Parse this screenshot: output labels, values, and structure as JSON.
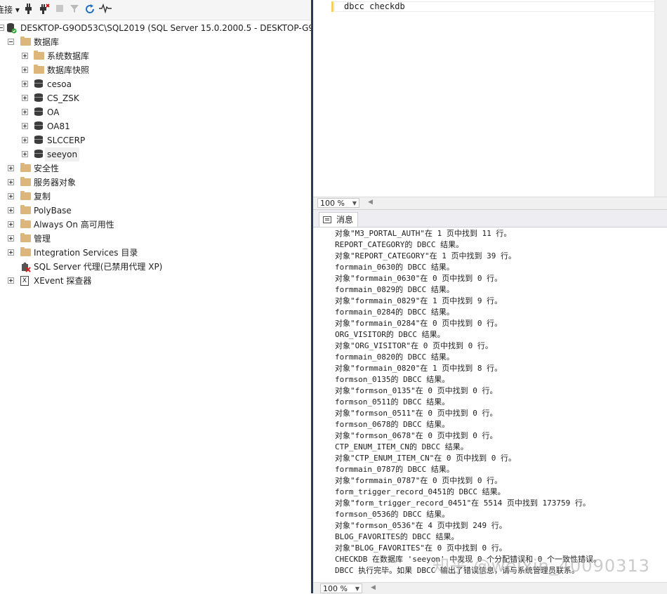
{
  "toolbar": {
    "connect_label": "连接",
    "icons": [
      "connect-plug-icon",
      "disconnect-plug-icon",
      "stop-icon",
      "filter-icon",
      "refresh-icon",
      "activity-monitor-icon"
    ]
  },
  "tree": {
    "server": "DESKTOP-G9OD53C\\SQL2019 (SQL Server 15.0.2000.5 - DESKTOP-G9O",
    "databases_folder": "数据库",
    "children": [
      {
        "label": "系统数据库",
        "type": "folder"
      },
      {
        "label": "数据库快照",
        "type": "folder"
      },
      {
        "label": "cesoa",
        "type": "db"
      },
      {
        "label": "CS_ZSK",
        "type": "db"
      },
      {
        "label": "OA",
        "type": "db"
      },
      {
        "label": "OA81",
        "type": "db"
      },
      {
        "label": "SLCCERP",
        "type": "db"
      },
      {
        "label": "seeyon",
        "type": "db"
      }
    ],
    "top_folders": [
      {
        "label": "安全性"
      },
      {
        "label": "服务器对象"
      },
      {
        "label": "复制"
      },
      {
        "label": "PolyBase"
      },
      {
        "label": "Always On 高可用性"
      },
      {
        "label": "管理"
      },
      {
        "label": "Integration Services 目录"
      }
    ],
    "agent": "SQL Server 代理(已禁用代理 XP)",
    "xevent": "XEvent 探查器"
  },
  "editor": {
    "code": "dbcc checkdb",
    "zoom": "100 %"
  },
  "results": {
    "tab_label": "消息",
    "zoom": "100 %",
    "messages": [
      "对象\"M3_PORTAL_AUTH\"在 1 页中找到 11 行。",
      "REPORT_CATEGORY的 DBCC 结果。",
      "对象\"REPORT_CATEGORY\"在 1 页中找到 39 行。",
      "formmain_0630的 DBCC 结果。",
      "对象\"formmain_0630\"在 0 页中找到 0 行。",
      "formmain_0829的 DBCC 结果。",
      "对象\"formmain_0829\"在 1 页中找到 9 行。",
      "formmain_0284的 DBCC 结果。",
      "对象\"formmain_0284\"在 0 页中找到 0 行。",
      "ORG_VISITOR的 DBCC 结果。",
      "对象\"ORG_VISITOR\"在 0 页中找到 0 行。",
      "formmain_0820的 DBCC 结果。",
      "对象\"formmain_0820\"在 1 页中找到 8 行。",
      "formson_0135的 DBCC 结果。",
      "对象\"formson_0135\"在 0 页中找到 0 行。",
      "formson_0511的 DBCC 结果。",
      "对象\"formson_0511\"在 0 页中找到 0 行。",
      "formson_0678的 DBCC 结果。",
      "对象\"formson_0678\"在 0 页中找到 0 行。",
      "CTP_ENUM_ITEM_CN的 DBCC 结果。",
      "对象\"CTP_ENUM_ITEM_CN\"在 0 页中找到 0 行。",
      "formmain_0787的 DBCC 结果。",
      "对象\"formmain_0787\"在 0 页中找到 0 行。",
      "form_trigger_record_0451的 DBCC 结果。",
      "对象\"form_trigger_record_0451\"在 5514 页中找到 173759 行。",
      "formson_0536的 DBCC 结果。",
      "对象\"formson_0536\"在 4 页中找到 249 行。",
      "BLOG_FAVORITES的 DBCC 结果。",
      "对象\"BLOG_FAVORITES\"在 0 页中找到 0 行。",
      "CHECKDB 在数据库 'seeyon' 中发现 0 个分配错误和 0 个一致性错误。",
      "DBCC 执行完毕。如果 DBCC 输出了错误信息，请与系统管理员联系。"
    ]
  },
  "watermark": "知乎 @weixin_40090313"
}
